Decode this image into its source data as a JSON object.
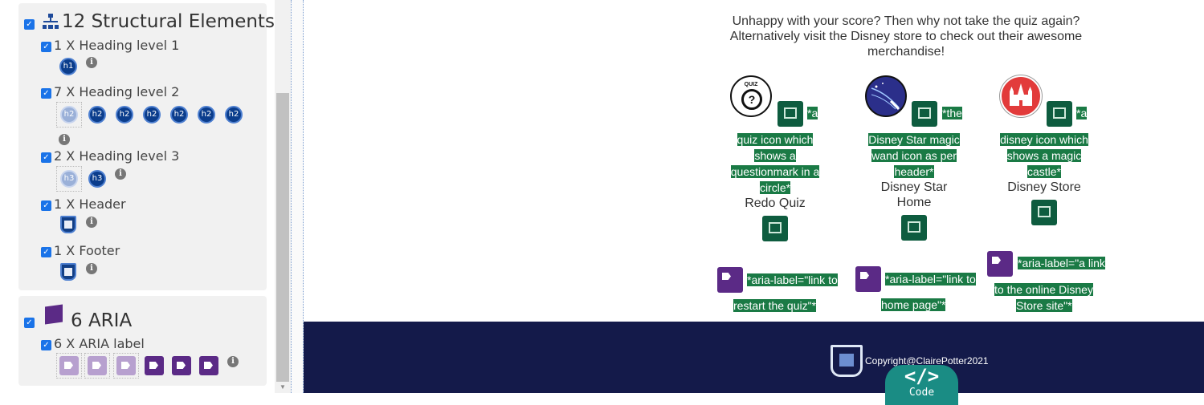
{
  "sidebar": {
    "structural": {
      "title": "12 Structural Elements",
      "groups": [
        {
          "label": "1 X Heading level 1",
          "icon_text": "h1"
        },
        {
          "label": "7 X Heading level 2",
          "icon_text": "h2"
        },
        {
          "label": "2 X Heading level 3",
          "icon_text": "h3"
        },
        {
          "label": "1 X Header"
        },
        {
          "label": "1 X Footer"
        }
      ]
    },
    "aria": {
      "title": "6 ARIA",
      "groups": [
        {
          "label": "6 X ARIA label"
        }
      ]
    },
    "check_glyph": "✓",
    "info_glyph": "i"
  },
  "main": {
    "message_lines": [
      "Unhappy with your score? Then why not take the quiz again?",
      "Alternatively visit the Disney store to check out their awesome",
      "merchandise!"
    ],
    "cards": [
      {
        "alt_first": "*a",
        "alt_lines": [
          "quiz icon which",
          "shows a",
          "questionmark in a",
          "circle*"
        ],
        "title_lines": [
          "Redo Quiz"
        ],
        "aria_lines": [
          "*aria-label=\"link to",
          "restart the quiz\"*"
        ],
        "icon_text": "QUIZ"
      },
      {
        "alt_first": "*the",
        "alt_lines": [
          "Disney Star magic",
          "wand icon as per",
          "header*"
        ],
        "title_lines": [
          "Disney Star",
          "Home"
        ],
        "aria_lines": [
          "*aria-label=\"link to",
          "home page\"*"
        ]
      },
      {
        "alt_first": "*a",
        "alt_lines": [
          "disney icon which",
          "shows a magic",
          "castle*"
        ],
        "title_lines": [
          "Disney Store"
        ],
        "aria_lines": [
          "*aria-label=\"a link",
          "to the online Disney",
          "Store site\"*"
        ]
      }
    ]
  },
  "footer": {
    "copyright": "Copyright@ClairePotter2021",
    "code_symbol": "</>",
    "code_label": "Code"
  },
  "colors": {
    "footer_bg": "#141a4a",
    "highlight_green": "#1a7a45",
    "aria_purple": "#5b2a86",
    "heading_blue": "#0b3d8c"
  }
}
